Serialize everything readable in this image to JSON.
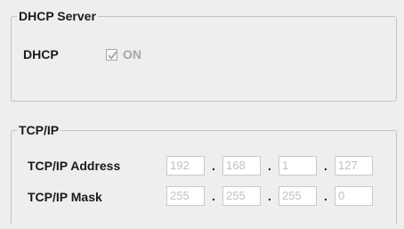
{
  "dhcp_server": {
    "group_title": "DHCP Server",
    "dhcp_label": "DHCP",
    "on_checked": true,
    "on_label": "ON"
  },
  "tcpip": {
    "group_title": "TCP/IP",
    "address": {
      "label": "TCP/IP Address",
      "octets": [
        "192",
        "168",
        "1",
        "127"
      ],
      "separators": [
        ".",
        ".",
        "."
      ]
    },
    "mask": {
      "label": "TCP/IP Mask",
      "octets": [
        "255",
        "255",
        "255",
        "0"
      ],
      "separators": [
        ".",
        ".",
        "."
      ]
    }
  },
  "colors": {
    "background": "#eeeeee",
    "border": "#c3c3c3",
    "disabled_text": "#c0c0c0",
    "label_text": "#1a1a1a"
  },
  "icons": {
    "checkbox_mark": "check-icon"
  }
}
